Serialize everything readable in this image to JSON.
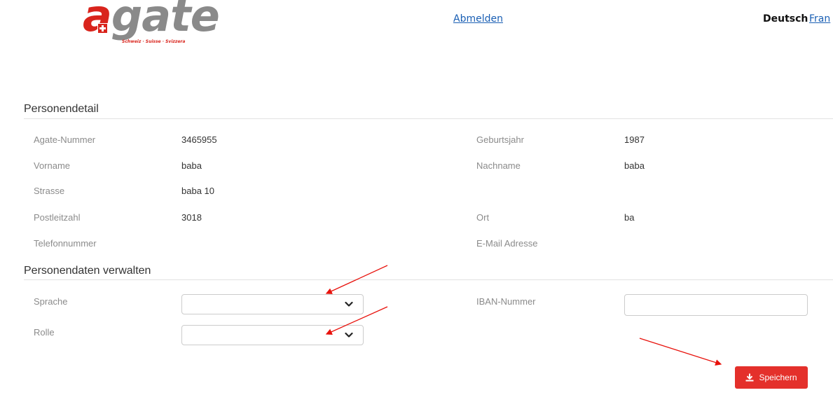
{
  "header": {
    "logo": {
      "first_letter": "a",
      "rest": "gate",
      "tagline": "Schweiz · Suisse · Svizzera"
    },
    "logout_label": "Abmelden",
    "languages": {
      "current": "Deutsch",
      "next": "Fran"
    }
  },
  "person_detail": {
    "title": "Personendetail",
    "fields": {
      "agate_nummer": {
        "label": "Agate-Nummer",
        "value": "3465955"
      },
      "geburtsjahr": {
        "label": "Geburtsjahr",
        "value": "1987"
      },
      "vorname": {
        "label": "Vorname",
        "value": "baba"
      },
      "nachname": {
        "label": "Nachname",
        "value": "baba"
      },
      "strasse": {
        "label": "Strasse",
        "value": "baba 10"
      },
      "postleitzahl": {
        "label": "Postleitzahl",
        "value": "3018"
      },
      "ort": {
        "label": "Ort",
        "value": "ba"
      },
      "telefonnummer": {
        "label": "Telefonnummer",
        "value": ""
      },
      "email": {
        "label": "E-Mail Adresse",
        "value": ""
      }
    }
  },
  "manage": {
    "title": "Personendaten verwalten",
    "sprache": {
      "label": "Sprache",
      "selected": ""
    },
    "rolle": {
      "label": "Rolle",
      "selected": ""
    },
    "iban": {
      "label": "IBAN-Nummer",
      "value": ""
    },
    "save_label": "Speichern"
  },
  "colors": {
    "accent_red": "#e4302b",
    "link_blue": "#1a5fb4",
    "logo_gray": "#8a8a8a",
    "annotation_arrow": "#e8120c"
  },
  "icons": {
    "select_chevron": "chevron-down-icon",
    "save": "download-icon"
  }
}
